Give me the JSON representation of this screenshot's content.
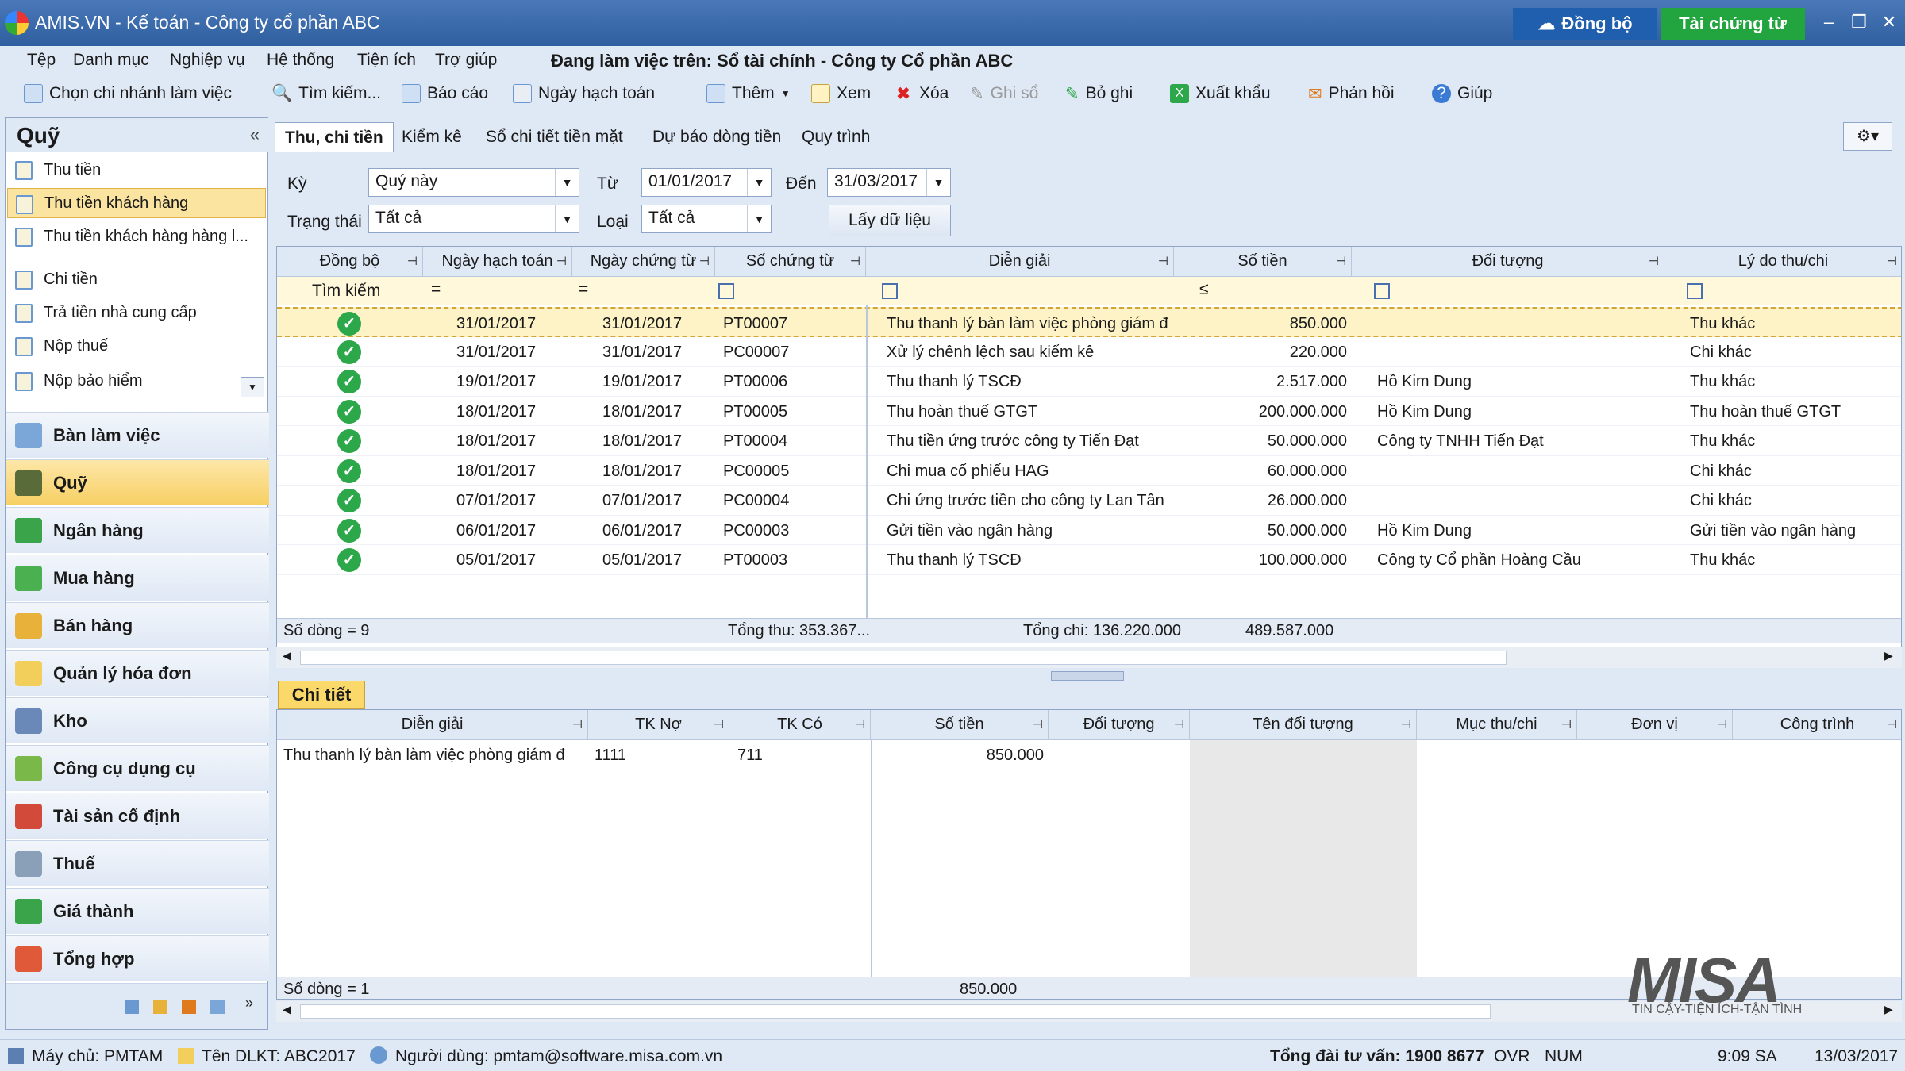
{
  "window": {
    "title": "AMIS.VN - Kế toán - Công ty cổ phần ABC",
    "sync_button": "Đồng bộ",
    "documents_button": "Tài chứng từ"
  },
  "menu": {
    "items": [
      "Tệp",
      "Danh mục",
      "Nghiệp vụ",
      "Hệ thống",
      "Tiện ích",
      "Trợ giúp"
    ],
    "working_on": "Đang làm việc trên: Sổ tài chính - Công ty Cổ phần ABC"
  },
  "toolbar": {
    "branch": "Chọn chi nhánh làm việc",
    "search": "Tìm kiếm...",
    "report": "Báo cáo",
    "posting_date": "Ngày hạch toán",
    "add": "Thêm",
    "view": "Xem",
    "delete": "Xóa",
    "post": "Ghi sổ",
    "unpost": "Bỏ ghi",
    "export": "Xuất khẩu",
    "feedback": "Phản hồi",
    "help": "Giúp"
  },
  "sidebar": {
    "header": "Quỹ",
    "collapse": "«",
    "quick_items": [
      "Thu tiền",
      "Thu tiền khách hàng",
      "Thu tiền khách hàng hàng l...",
      "Chi tiền",
      "Trả tiền nhà cung cấp",
      "Nộp thuế",
      "Nộp bảo hiểm"
    ],
    "modules": [
      "Bàn làm việc",
      "Quỹ",
      "Ngân hàng",
      "Mua hàng",
      "Bán hàng",
      "Quản lý hóa đơn",
      "Kho",
      "Công cụ dụng cụ",
      "Tài sản cố định",
      "Thuế",
      "Giá thành",
      "Tổng hợp"
    ]
  },
  "tabs": [
    "Thu, chi tiền",
    "Kiểm kê",
    "Sổ chi tiết tiền mặt",
    "Dự báo dòng tiền",
    "Quy trình"
  ],
  "filters": {
    "period_label": "Kỳ",
    "period_value": "Quý này",
    "from_label": "Từ",
    "from_value": "01/01/2017",
    "to_label": "Đến",
    "to_value": "31/03/2017",
    "status_label": "Trạng thái",
    "status_value": "Tất cả",
    "type_label": "Loại",
    "type_value": "Tất cả",
    "fetch_button": "Lấy dữ liệu"
  },
  "grid": {
    "columns": [
      "Đồng bộ",
      "Ngày hạch toán",
      "Ngày chứng từ",
      "Số chứng từ",
      "Diễn giải",
      "Số tiền",
      "Đối tượng",
      "Lý do thu/chi"
    ],
    "filter_row": {
      "search": "Tìm kiếm",
      "eq1": "=",
      "eq2": "=",
      "le": "≤"
    },
    "rows": [
      {
        "posted": "31/01/2017",
        "doc_date": "31/01/2017",
        "doc_no": "PT00007",
        "desc": "Thu thanh lý bàn làm việc phòng giám đ",
        "amount": "850.000",
        "object": "",
        "reason": "Thu khác"
      },
      {
        "posted": "31/01/2017",
        "doc_date": "31/01/2017",
        "doc_no": "PC00007",
        "desc": "Xử lý chênh lệch sau kiểm kê",
        "amount": "220.000",
        "object": "",
        "reason": "Chi khác"
      },
      {
        "posted": "19/01/2017",
        "doc_date": "19/01/2017",
        "doc_no": "PT00006",
        "desc": "Thu thanh lý TSCĐ",
        "amount": "2.517.000",
        "object": "Hồ Kim Dung",
        "reason": "Thu khác"
      },
      {
        "posted": "18/01/2017",
        "doc_date": "18/01/2017",
        "doc_no": "PT00005",
        "desc": "Thu hoàn thuế GTGT",
        "amount": "200.000.000",
        "object": "Hồ Kim Dung",
        "reason": "Thu hoàn thuế GTGT"
      },
      {
        "posted": "18/01/2017",
        "doc_date": "18/01/2017",
        "doc_no": "PT00004",
        "desc": "Thu tiền ứng trước công ty Tiến Đạt",
        "amount": "50.000.000",
        "object": "Công ty TNHH Tiến Đạt",
        "reason": "Thu khác"
      },
      {
        "posted": "18/01/2017",
        "doc_date": "18/01/2017",
        "doc_no": "PC00005",
        "desc": "Chi mua cổ phiếu HAG",
        "amount": "60.000.000",
        "object": "",
        "reason": "Chi khác"
      },
      {
        "posted": "07/01/2017",
        "doc_date": "07/01/2017",
        "doc_no": "PC00004",
        "desc": "Chi ứng trước tiền cho công ty Lan Tân",
        "amount": "26.000.000",
        "object": "",
        "reason": "Chi khác"
      },
      {
        "posted": "06/01/2017",
        "doc_date": "06/01/2017",
        "doc_no": "PC00003",
        "desc": "Gửi tiền vào ngân hàng",
        "amount": "50.000.000",
        "object": "Hồ Kim Dung",
        "reason": "Gửi tiền vào ngân hàng"
      },
      {
        "posted": "05/01/2017",
        "doc_date": "05/01/2017",
        "doc_no": "PT00003",
        "desc": "Thu thanh lý TSCĐ",
        "amount": "100.000.000",
        "object": "Công ty Cổ phần Hoàng Cầu",
        "reason": "Thu khác"
      }
    ],
    "footer": {
      "rows": "Số dòng = 9",
      "total_in": "Tổng thu: 353.367...",
      "total_out": "Tổng chi: 136.220.000",
      "total": "489.587.000"
    }
  },
  "detail": {
    "tab": "Chi tiết",
    "columns": [
      "Diễn giải",
      "TK Nợ",
      "TK Có",
      "Số tiền",
      "Đối tượng",
      "Tên đối tượng",
      "Mục thu/chi",
      "Đơn vị",
      "Công trình"
    ],
    "rows": [
      {
        "desc": "Thu thanh lý bàn làm việc phòng giám đ",
        "debit": "1111",
        "credit": "711",
        "amount": "850.000"
      }
    ],
    "footer": {
      "rows": "Số dòng = 1",
      "amount": "850.000"
    }
  },
  "brand": {
    "logo": "MISA",
    "tagline": "TIN CẬY-TIỆN ÍCH-TẬN TÌNH"
  },
  "statusbar": {
    "server": "Máy chủ: PMTAM",
    "db": "Tên DLKT: ABC2017",
    "user": "Người dùng: pmtam@software.misa.com.vn",
    "hotline": "Tổng đài tư vấn: 1900 8677",
    "ovr": "OVR",
    "num": "NUM",
    "time": "9:09 SA",
    "date": "13/03/2017"
  },
  "colors": {
    "accent": "#2f5f9f",
    "ok": "#2ca84a",
    "highlight": "#fbd86a"
  }
}
